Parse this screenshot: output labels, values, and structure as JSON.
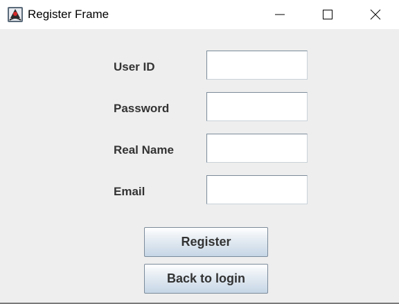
{
  "window": {
    "title": "Register Frame",
    "icon": "java-duke-icon",
    "controls": [
      "minimize-icon",
      "maximize-icon",
      "close-icon"
    ]
  },
  "form": {
    "fields": [
      {
        "label": "User ID",
        "value": "",
        "placeholder": ""
      },
      {
        "label": "Password",
        "value": "",
        "placeholder": ""
      },
      {
        "label": "Real Name",
        "value": "",
        "placeholder": ""
      },
      {
        "label": "Email",
        "value": "",
        "placeholder": ""
      }
    ],
    "register_label": "Register",
    "back_label": "Back to login"
  },
  "colors": {
    "background": "#eeeeee",
    "titlebar": "#ffffff",
    "label_text": "#333333",
    "button_top": "#ffffff",
    "button_bottom": "#c6d6e6",
    "field_border": "#7a8a99"
  }
}
